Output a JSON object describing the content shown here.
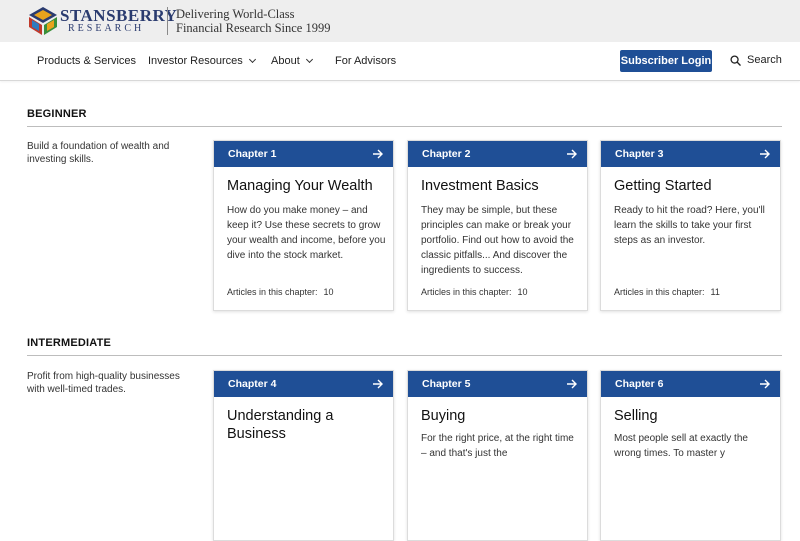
{
  "brand": {
    "name": "STANSBERRY",
    "sub": "RESEARCH",
    "tagline_line1": "Delivering World-Class",
    "tagline_line2": "Financial Research Since 1999"
  },
  "nav": {
    "items": [
      {
        "label": "Products & Services",
        "dropdown": false
      },
      {
        "label": "Investor Resources",
        "dropdown": true
      },
      {
        "label": "About",
        "dropdown": true
      },
      {
        "label": "For Advisors",
        "dropdown": false
      }
    ],
    "login_label": "Subscriber Login",
    "search_label": "Search"
  },
  "sections": [
    {
      "title": "BEGINNER",
      "description": "Build a foundation of wealth and investing skills.",
      "cards": [
        {
          "chapter": "Chapter 1",
          "title": "Managing Your Wealth",
          "text": "How do you make money – and keep it? Use these secrets to grow your wealth and income, before you dive into the stock market.",
          "count_label": "Articles in this chapter:",
          "count": "10"
        },
        {
          "chapter": "Chapter 2",
          "title": "Investment Basics",
          "text": "They may be simple, but these principles can make or break your portfolio. Find out how to avoid the classic pitfalls... And discover the ingredients to success.",
          "count_label": "Articles in this chapter:",
          "count": "10"
        },
        {
          "chapter": "Chapter 3",
          "title": "Getting Started",
          "text": "Ready to hit the road? Here, you'll learn the skills to take your first steps as an investor.",
          "count_label": "Articles in this chapter:",
          "count": "11"
        }
      ]
    },
    {
      "title": "INTERMEDIATE",
      "description": "Profit from high-quality businesses with well-timed trades.",
      "cards": [
        {
          "chapter": "Chapter 4",
          "title": "Understanding a Business",
          "text": "",
          "count_label": "",
          "count": ""
        },
        {
          "chapter": "Chapter 5",
          "title": "Buying",
          "text": "For the right price, at the right time – and that's just the",
          "count_label": "",
          "count": ""
        },
        {
          "chapter": "Chapter 6",
          "title": "Selling",
          "text": "Most people sell at exactly the wrong times. To master y",
          "count_label": "",
          "count": ""
        }
      ]
    }
  ],
  "colors": {
    "accent": "#1f4f96",
    "brand_text": "#2a3b6f",
    "brand_bar_bg": "#eeeeee"
  }
}
